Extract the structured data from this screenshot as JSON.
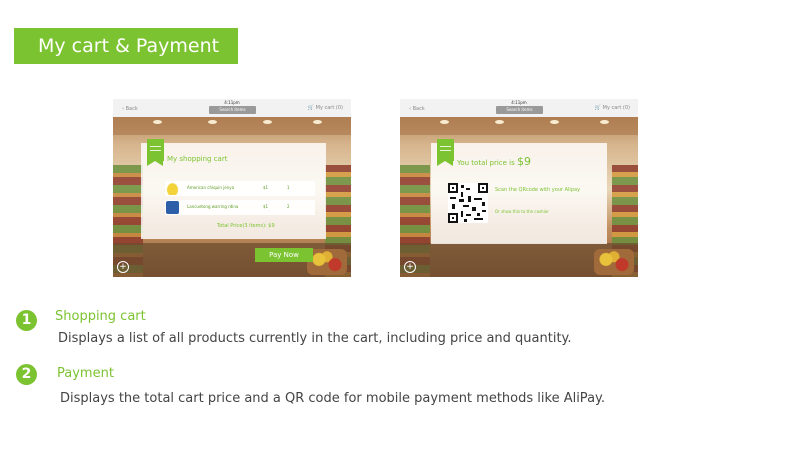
{
  "header": {
    "title": "My cart & Payment"
  },
  "screens": {
    "status": {
      "time": "4:11pm",
      "back": "Back",
      "search": "Search items",
      "cart": "My cart (0)"
    },
    "cart": {
      "title": "My shopping cart",
      "items": [
        {
          "name": "American chiquin jenya",
          "price": "$1",
          "qty": "1",
          "icon": "banana"
        },
        {
          "name": "Lancuetong warring rdina",
          "price": "$1",
          "qty": "2",
          "icon": "yogurt"
        }
      ],
      "total": "Total Price(3 items):  $9",
      "pay_label": "Pay Now"
    },
    "payment": {
      "title_prefix": "You total price is",
      "amount": "$9",
      "scan_text": "Scan the QRcode  with your Alipay",
      "or_text": "Or show this to the cashier"
    },
    "plus_icon": "+"
  },
  "sections": [
    {
      "number": "1",
      "title": "Shopping cart",
      "description": "Displays a list of all products currently in the cart, including price and quantity."
    },
    {
      "number": "2",
      "title": "Payment",
      "description": "Displays the total cart price and a QR code for mobile payment methods like AliPay."
    }
  ],
  "colors": {
    "accent": "#7cc331",
    "text": "#444444"
  }
}
